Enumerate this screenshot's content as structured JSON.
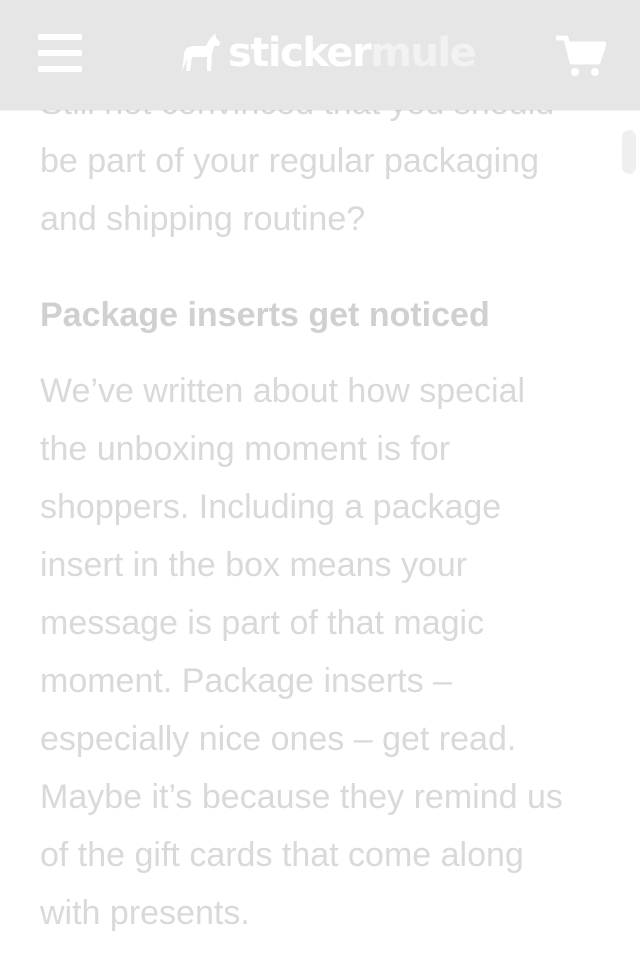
{
  "header": {
    "logo": {
      "sticker": "sticker",
      "mule": "mule"
    },
    "menu_icon": "hamburger-menu-icon",
    "cart_icon": "shopping-cart-icon",
    "colors": {
      "bar_background": "#e6e6e6",
      "icons": "#ffffff"
    }
  },
  "article": {
    "intro_text": "Still not convinced that you should be part of your regular packaging and shipping routine?",
    "heading": "Package inserts get noticed",
    "body_text": "We’ve written about how special the unboxing moment is for shoppers. Including a package insert in the box means your message is part of that magic moment. Package inserts – especially nice ones – get read. Maybe it’s because they remind us of the gift cards that come along with presents.",
    "text_color": "#d9d9d9"
  }
}
